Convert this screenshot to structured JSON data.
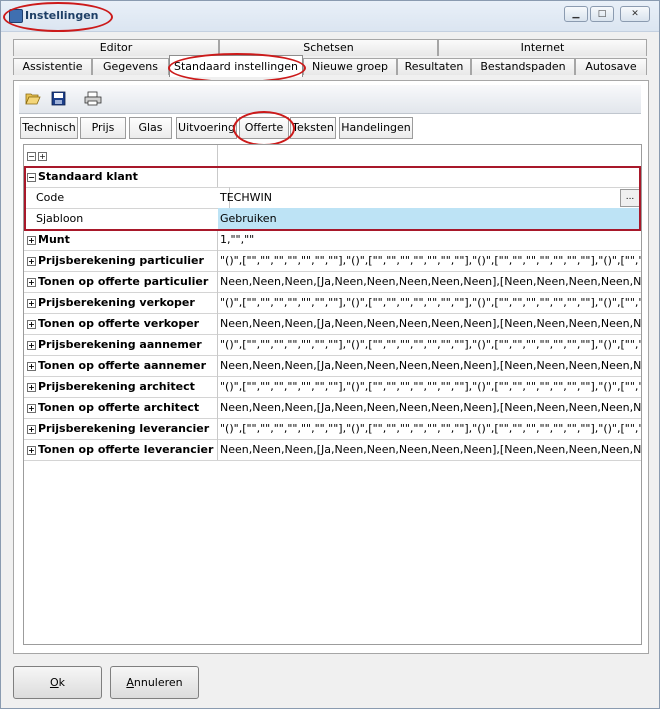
{
  "window": {
    "title": "Instellingen",
    "controls": {
      "minimize": "▁",
      "maximize": "□",
      "close": "✕"
    }
  },
  "tabs_row1": [
    "Editor",
    "Schetsen",
    "Internet"
  ],
  "tabs_row2": [
    "Assistentie",
    "Gegevens",
    "Standaard instellingen",
    "Nieuwe groep",
    "Resultaten",
    "Bestandspaden",
    "Autosave"
  ],
  "toolbar": {
    "icons": [
      "folder-open-icon",
      "save-icon",
      "print-icon"
    ]
  },
  "subtabs": [
    "Technisch",
    "Prijs",
    "Glas",
    "Uitvoering",
    "Offerte",
    "Teksten",
    "Handelingen"
  ],
  "grid": {
    "header_icons": [
      "collapse-all",
      "expand-all"
    ],
    "group": {
      "label": "Standaard klant",
      "expanded": true
    },
    "children": [
      {
        "name": "Code",
        "value": "TECHWIN",
        "button": "..."
      },
      {
        "name": "Sjabloon",
        "value": "Gebruiken"
      }
    ],
    "rows": [
      {
        "name": "Munt",
        "value": "1,\"\",\"\""
      },
      {
        "name": "Prijsberekening particulier",
        "value": "\"()\",[\"\",\"\",\"\",\"\",\"\",\"\",\"\"],\"()\",[\"\",\"\",\"\",\"\",\"\",\"\",\"\"],\"()\",[\"\",\"\",\"\",\"\",\"\",\"\",\"\"],\"()\",[\"\",\"\",\"\",\"\",\"\""
      },
      {
        "name": "Tonen op offerte particulier",
        "value": "Neen,Neen,Neen,[Ja,Neen,Neen,Neen,Neen,Neen],[Neen,Neen,Neen,Neen,Neen,Nee"
      },
      {
        "name": "Prijsberekening verkoper",
        "value": "\"()\",[\"\",\"\",\"\",\"\",\"\",\"\",\"\"],\"()\",[\"\",\"\",\"\",\"\",\"\",\"\",\"\"],\"()\",[\"\",\"\",\"\",\"\",\"\",\"\",\"\"],\"()\",[\"\",\"\",\"\",\"\",\"\""
      },
      {
        "name": "Tonen op offerte verkoper",
        "value": "Neen,Neen,Neen,[Ja,Neen,Neen,Neen,Neen,Neen],[Neen,Neen,Neen,Neen,Neen,Nee"
      },
      {
        "name": "Prijsberekening aannemer",
        "value": "\"()\",[\"\",\"\",\"\",\"\",\"\",\"\",\"\"],\"()\",[\"\",\"\",\"\",\"\",\"\",\"\",\"\"],\"()\",[\"\",\"\",\"\",\"\",\"\",\"\",\"\"],\"()\",[\"\",\"\",\"\",\"\",\"\""
      },
      {
        "name": "Tonen op offerte aannemer",
        "value": "Neen,Neen,Neen,[Ja,Neen,Neen,Neen,Neen,Neen],[Neen,Neen,Neen,Neen,Neen,Nee"
      },
      {
        "name": "Prijsberekening architect",
        "value": "\"()\",[\"\",\"\",\"\",\"\",\"\",\"\",\"\"],\"()\",[\"\",\"\",\"\",\"\",\"\",\"\",\"\"],\"()\",[\"\",\"\",\"\",\"\",\"\",\"\",\"\"],\"()\",[\"\",\"\",\"\",\"\",\"\""
      },
      {
        "name": "Tonen op offerte architect",
        "value": "Neen,Neen,Neen,[Ja,Neen,Neen,Neen,Neen,Neen],[Neen,Neen,Neen,Neen,Neen,Nee"
      },
      {
        "name": "Prijsberekening leverancier",
        "value": "\"()\",[\"\",\"\",\"\",\"\",\"\",\"\",\"\"],\"()\",[\"\",\"\",\"\",\"\",\"\",\"\",\"\"],\"()\",[\"\",\"\",\"\",\"\",\"\",\"\",\"\"],\"()\",[\"\",\"\",\"\",\"\",\"\""
      },
      {
        "name": "Tonen op offerte leverancier",
        "value": "Neen,Neen,Neen,[Ja,Neen,Neen,Neen,Neen,Neen],[Neen,Neen,Neen,Neen,Neen,Nee"
      }
    ]
  },
  "buttons": {
    "ok_mnemonic": "O",
    "ok_rest": "k",
    "cancel_mnemonic": "A",
    "cancel_rest": "nnuleren"
  },
  "colors": {
    "annotation_red": "#cc1a1a",
    "selection": "#bde3f5"
  }
}
